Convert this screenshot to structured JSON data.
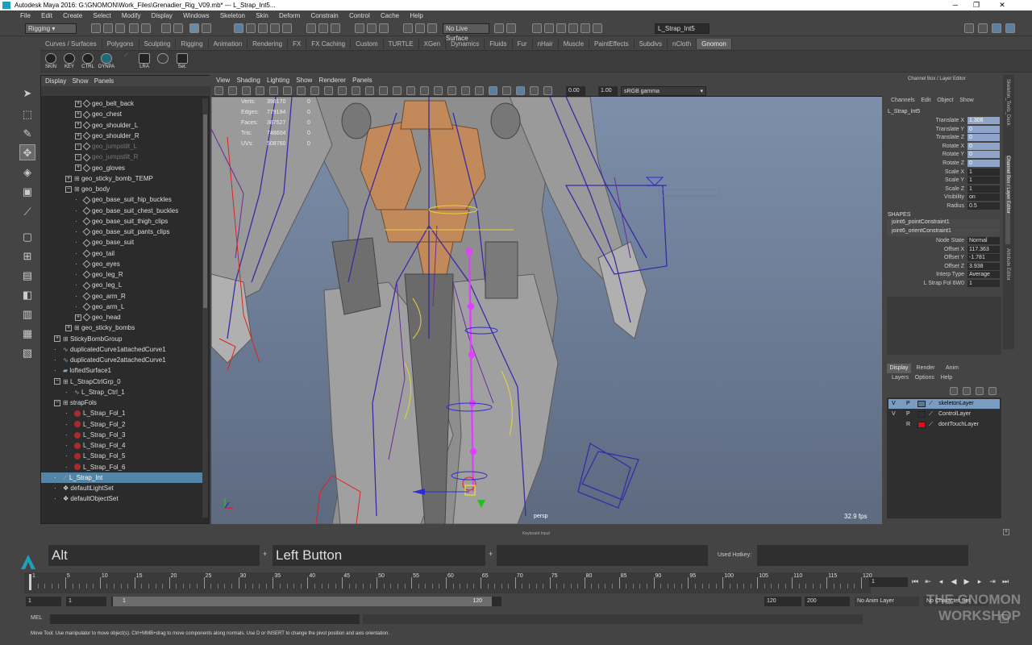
{
  "window": {
    "title": "Autodesk Maya 2016: G:\\GNOMON\\Work_Files\\Grenadier_Rig_V09.mb*  ---  L_Strap_Int5...",
    "minimize": "─",
    "restore": "❐",
    "close": "✕"
  },
  "menubar": [
    "File",
    "Edit",
    "Create",
    "Select",
    "Modify",
    "Display",
    "Windows",
    "Skeleton",
    "Skin",
    "Deform",
    "Constrain",
    "Control",
    "Cache",
    "Help"
  ],
  "status": {
    "menuset": "Rigging",
    "live_surface": "No Live Surface",
    "target_field": "L_Strap_Int5"
  },
  "shelf_tabs": [
    "Curves / Surfaces",
    "Polygons",
    "Sculpting",
    "Rigging",
    "Animation",
    "Rendering",
    "FX",
    "FX Caching",
    "Custom",
    "TURTLE",
    "XGen",
    "Dynamics",
    "Fluids",
    "Fur",
    "nHair",
    "Muscle",
    "PaintEffects",
    "Subdivs",
    "nCloth",
    "Gnomon"
  ],
  "shelf_active": "Gnomon",
  "shelf_buttons": [
    "SKIN",
    "KEY",
    "CTRL",
    "DYNPA",
    "",
    "LRA",
    "",
    "Set."
  ],
  "outliner": {
    "menu": [
      "Display",
      "Show",
      "Panels"
    ],
    "rows": [
      {
        "label": "geo_belt_back",
        "indent": 1,
        "kind": "geo"
      },
      {
        "label": "geo_chest",
        "indent": 1,
        "kind": "geo"
      },
      {
        "label": "geo_shoulder_L",
        "indent": 1,
        "kind": "geo"
      },
      {
        "label": "geo_shoulder_R",
        "indent": 1,
        "kind": "geo"
      },
      {
        "label": "geo_jumpstilt_L",
        "indent": 1,
        "kind": "geo",
        "dim": true
      },
      {
        "label": "geo_jumpstilt_R",
        "indent": 1,
        "kind": "geo",
        "dim": true
      },
      {
        "label": "geo_gloves",
        "indent": 1,
        "kind": "geo"
      },
      {
        "label": "geo_sticky_bomb_TEMP",
        "indent": 0,
        "kind": "grp"
      },
      {
        "label": "geo_body",
        "indent": 0,
        "kind": "grp",
        "open": true
      },
      {
        "label": "geo_base_suit_hip_buckles",
        "indent": 1,
        "kind": "mesh"
      },
      {
        "label": "geo_base_suit_chest_buckles",
        "indent": 1,
        "kind": "mesh"
      },
      {
        "label": "geo_base_suit_thigh_clips",
        "indent": 1,
        "kind": "mesh"
      },
      {
        "label": "geo_base_suit_pants_clips",
        "indent": 1,
        "kind": "mesh"
      },
      {
        "label": "geo_base_suit",
        "indent": 1,
        "kind": "mesh"
      },
      {
        "label": "geo_tail",
        "indent": 1,
        "kind": "mesh"
      },
      {
        "label": "geo_eyes",
        "indent": 1,
        "kind": "mesh"
      },
      {
        "label": "geo_leg_R",
        "indent": 1,
        "kind": "mesh"
      },
      {
        "label": "geo_leg_L",
        "indent": 1,
        "kind": "mesh"
      },
      {
        "label": "geo_arm_R",
        "indent": 1,
        "kind": "mesh"
      },
      {
        "label": "geo_arm_L",
        "indent": 1,
        "kind": "mesh"
      },
      {
        "label": "geo_head",
        "indent": 1,
        "kind": "geo"
      },
      {
        "label": "geo_sticky_bombs",
        "indent": 0,
        "kind": "grp"
      },
      {
        "label": "StickyBombGroup",
        "indent": -1,
        "kind": "grp"
      },
      {
        "label": "duplicatedCurve1attachedCurve1",
        "indent": -1,
        "kind": "curve"
      },
      {
        "label": "duplicatedCurve2attachedCurve1",
        "indent": -1,
        "kind": "curve"
      },
      {
        "label": "loftedSurface1",
        "indent": -1,
        "kind": "surf"
      },
      {
        "label": "L_StrapCtrlGrp_0",
        "indent": -1,
        "kind": "grp",
        "open": true
      },
      {
        "label": "L_Strap_Ctrl_1",
        "indent": 0,
        "kind": "curve"
      },
      {
        "label": "strapFols",
        "indent": -1,
        "kind": "grp",
        "open": true
      },
      {
        "label": "L_Strap_Fol_1",
        "indent": 0,
        "kind": "fol"
      },
      {
        "label": "L_Strap_Fol_2",
        "indent": 0,
        "kind": "fol"
      },
      {
        "label": "L_Strap_Fol_3",
        "indent": 0,
        "kind": "fol"
      },
      {
        "label": "L_Strap_Fol_4",
        "indent": 0,
        "kind": "fol"
      },
      {
        "label": "L_Strap_Fol_5",
        "indent": 0,
        "kind": "fol"
      },
      {
        "label": "L_Strap_Fol_6",
        "indent": 0,
        "kind": "fol"
      },
      {
        "label": "L_Strap_Int",
        "indent": -1,
        "kind": "joint",
        "selected": true
      },
      {
        "label": "defaultLightSet",
        "indent": -1,
        "kind": "set"
      },
      {
        "label": "defaultObjectSet",
        "indent": -1,
        "kind": "set"
      }
    ]
  },
  "viewport": {
    "menu": [
      "View",
      "Shading",
      "Lighting",
      "Show",
      "Renderer",
      "Panels"
    ],
    "exposure": "0.00",
    "gamma": "1.00",
    "colorspace": "sRGB gamma",
    "hud": [
      {
        "label": "Verts:",
        "value": "398170",
        "sel": "0"
      },
      {
        "label": "Edges:",
        "value": "779194",
        "sel": "0"
      },
      {
        "label": "Faces:",
        "value": "387527",
        "sel": "0"
      },
      {
        "label": "Tris:",
        "value": "748604",
        "sel": "0"
      },
      {
        "label": "UVs:",
        "value": "508760",
        "sel": "0"
      }
    ],
    "camera": "persp",
    "fps": "32.9 fps"
  },
  "channelbox": {
    "header": "Channel Box / Layer Editor",
    "menu": [
      "Channels",
      "Edit",
      "Object",
      "Show"
    ],
    "object": "L_Strap_Int5",
    "attrs": [
      {
        "label": "Translate X",
        "value": "1.306",
        "key": true
      },
      {
        "label": "Translate Y",
        "value": "0",
        "key": true
      },
      {
        "label": "Translate Z",
        "value": "0",
        "key": true
      },
      {
        "label": "Rotate X",
        "value": "0",
        "key": true
      },
      {
        "label": "Rotate Y",
        "value": "0",
        "key": true
      },
      {
        "label": "Rotate Z",
        "value": "0",
        "key": true
      },
      {
        "label": "Scale X",
        "value": "1",
        "key": false
      },
      {
        "label": "Scale Y",
        "value": "1",
        "key": false
      },
      {
        "label": "Scale Z",
        "value": "1",
        "key": false
      },
      {
        "label": "Visibility",
        "value": "on",
        "key": false
      },
      {
        "label": "Radius",
        "value": "0.5",
        "key": false
      }
    ],
    "shapes_header": "SHAPES",
    "shapes": [
      "joint6_pointConstraint1",
      "joint6_orientConstraint1"
    ],
    "shape_attrs": [
      {
        "label": "Node State",
        "value": "Normal"
      },
      {
        "label": "Offset X",
        "value": "117.363"
      },
      {
        "label": "Offset Y",
        "value": "-1.781"
      },
      {
        "label": "Offset Z",
        "value": "3.938"
      },
      {
        "label": "Interp Type",
        "value": "Average"
      },
      {
        "label": "L Strap Fol 6W0",
        "value": "1"
      }
    ]
  },
  "side_tabs": [
    "Skeleton_Tools_Deck",
    "Channel Box / Layer Editor",
    "Attribute Editor"
  ],
  "layers": {
    "tabs": [
      "Display",
      "Render",
      "Anim"
    ],
    "menu": [
      "Layers",
      "Options",
      "Help"
    ],
    "items": [
      {
        "v": "V",
        "p": "P",
        "name": "skeletonLayer",
        "color": "#5a7896",
        "selected": true
      },
      {
        "v": "V",
        "p": "P",
        "name": "ControlLayer",
        "color": "",
        "selected": false
      },
      {
        "v": "",
        "p": "R",
        "name": "dontTouchLayer",
        "color": "#d4141c",
        "selected": false
      }
    ]
  },
  "keyinput": {
    "title": "Keyboard Input",
    "modifier": "Alt",
    "plus1": "+",
    "mouse": "Left Button",
    "plus2": "+",
    "hotkey_label": "Used Hotkey:"
  },
  "timeline": {
    "ticks": [
      "1",
      "5",
      "10",
      "15",
      "20",
      "25",
      "30",
      "35",
      "40",
      "45",
      "50",
      "55",
      "60",
      "65",
      "70",
      "75",
      "80",
      "85",
      "90",
      "95",
      "100",
      "105",
      "110",
      "115",
      "120"
    ],
    "current_frame": "1"
  },
  "range": {
    "start": "1",
    "anim_start": "1",
    "slider_start": "1",
    "slider_end": "120",
    "end": "120",
    "anim_end": "200",
    "anim_layer": "No Anim Layer",
    "char_set": "No Character Set"
  },
  "mel": {
    "label": "MEL"
  },
  "helpline": "Move Tool: Use manipulator to move object(s). Ctrl+MMB+drag to move components along normals. Use D or INSERT to change the pivot position and axis orientation.",
  "watermark": {
    "line1": "THE GNOMON",
    "line2": "WORKSHOP"
  },
  "colors": {
    "accent": "#5285a6",
    "key": "#8fa4c8",
    "viewport_top": "#7d8fab",
    "rig_magenta": "#e040ff",
    "rig_blue": "#2c2cd6",
    "rig_red": "#e02020"
  }
}
